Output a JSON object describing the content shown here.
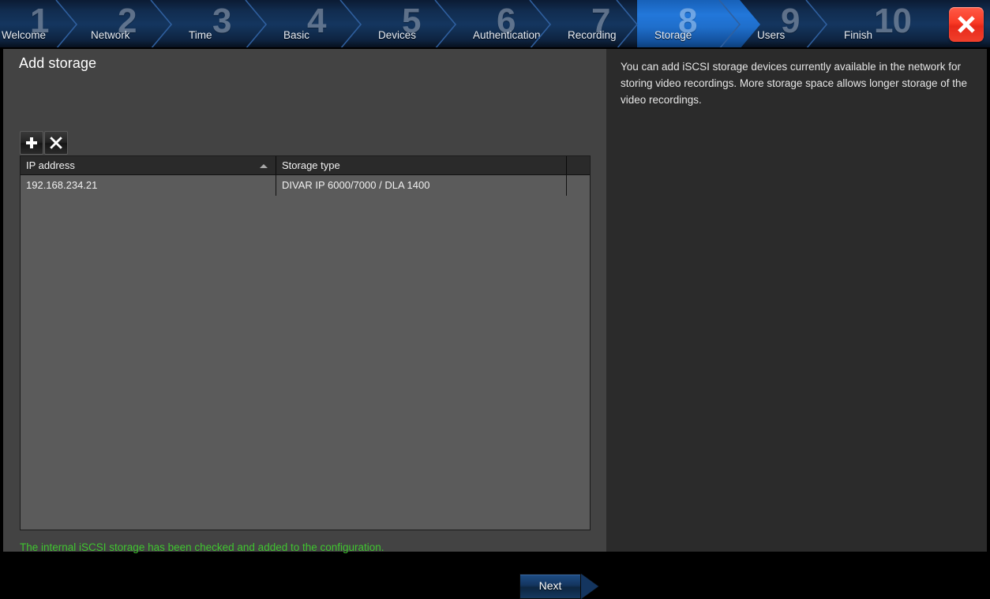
{
  "wizard": {
    "steps": [
      {
        "number": "1",
        "label": "Welcome",
        "active": false
      },
      {
        "number": "2",
        "label": "Network",
        "active": false
      },
      {
        "number": "3",
        "label": "Time",
        "active": false
      },
      {
        "number": "4",
        "label": "Basic",
        "active": false
      },
      {
        "number": "5",
        "label": "Devices",
        "active": false
      },
      {
        "number": "6",
        "label": "Authentication",
        "active": false
      },
      {
        "number": "7",
        "label": "Recording",
        "active": false
      },
      {
        "number": "8",
        "label": "Storage",
        "active": true
      },
      {
        "number": "9",
        "label": "Users",
        "active": false
      },
      {
        "number": "10",
        "label": "Finish",
        "active": false
      }
    ],
    "close_icon": "close-x-icon",
    "accent_active": "#2277da",
    "close_color": "#f93a25"
  },
  "main": {
    "title": "Add storage",
    "toolbar": {
      "add_icon": "plus-icon",
      "add_label": "Add",
      "remove_icon": "x-icon",
      "remove_label": "Remove"
    },
    "table": {
      "columns": [
        {
          "key": "ip",
          "label": "IP address",
          "sorted": true,
          "sort_dir": "asc"
        },
        {
          "key": "type",
          "label": "Storage type",
          "sorted": false,
          "sort_dir": ""
        },
        {
          "key": "blank",
          "label": "",
          "sorted": false,
          "sort_dir": ""
        }
      ],
      "rows": [
        {
          "ip": "192.168.234.21",
          "type": "DIVAR IP 6000/7000 / DLA 1400",
          "blank": ""
        }
      ]
    },
    "status": {
      "text": "The internal iSCSI storage has been checked and added to the configuration.",
      "color": "#3fc42f"
    },
    "next_button": {
      "label": "Next"
    }
  },
  "help": {
    "text": "You can add iSCSI storage devices currently available in the network for storing video recordings. More storage space allows longer storage of the video recordings."
  }
}
